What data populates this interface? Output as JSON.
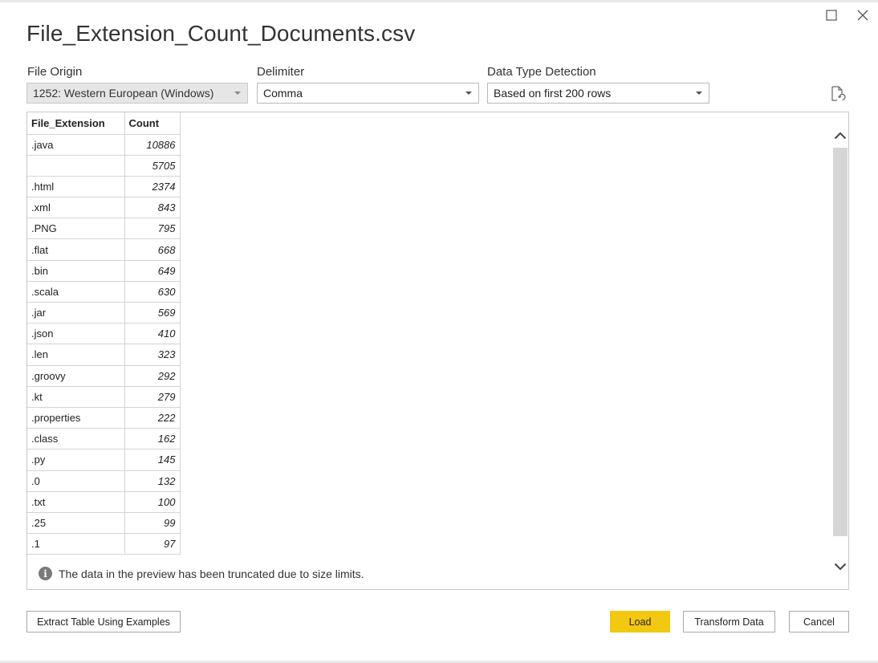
{
  "window": {
    "title": "File_Extension_Count_Documents.csv"
  },
  "options": {
    "file_origin": {
      "label": "File Origin",
      "value": "1252: Western European (Windows)"
    },
    "delimiter": {
      "label": "Delimiter",
      "value": "Comma"
    },
    "data_type_detection": {
      "label": "Data Type Detection",
      "value": "Based on first 200 rows"
    }
  },
  "table": {
    "columns": [
      "File_Extension",
      "Count"
    ],
    "rows": [
      [
        ".java",
        "10886"
      ],
      [
        "",
        "5705"
      ],
      [
        ".html",
        "2374"
      ],
      [
        ".xml",
        "843"
      ],
      [
        ".PNG",
        "795"
      ],
      [
        ".flat",
        "668"
      ],
      [
        ".bin",
        "649"
      ],
      [
        ".scala",
        "630"
      ],
      [
        ".jar",
        "569"
      ],
      [
        ".json",
        "410"
      ],
      [
        ".len",
        "323"
      ],
      [
        ".groovy",
        "292"
      ],
      [
        ".kt",
        "279"
      ],
      [
        ".properties",
        "222"
      ],
      [
        ".class",
        "162"
      ],
      [
        ".py",
        "145"
      ],
      [
        ".0",
        "132"
      ],
      [
        ".txt",
        "100"
      ],
      [
        ".25",
        "99"
      ],
      [
        ".1",
        "97"
      ]
    ]
  },
  "info_message": "The data in the preview has been truncated due to size limits.",
  "buttons": {
    "extract": "Extract Table Using Examples",
    "load": "Load",
    "transform": "Transform Data",
    "cancel": "Cancel"
  },
  "icons": {
    "maximize": "maximize-icon",
    "close": "close-icon",
    "refresh": "refresh-document-icon",
    "info": "info-icon",
    "scroll_up": "chevron-up-icon",
    "scroll_down": "chevron-down-icon"
  },
  "colors": {
    "load_button": "#f2c811",
    "scroll_thumb": "#d6d6d6"
  }
}
